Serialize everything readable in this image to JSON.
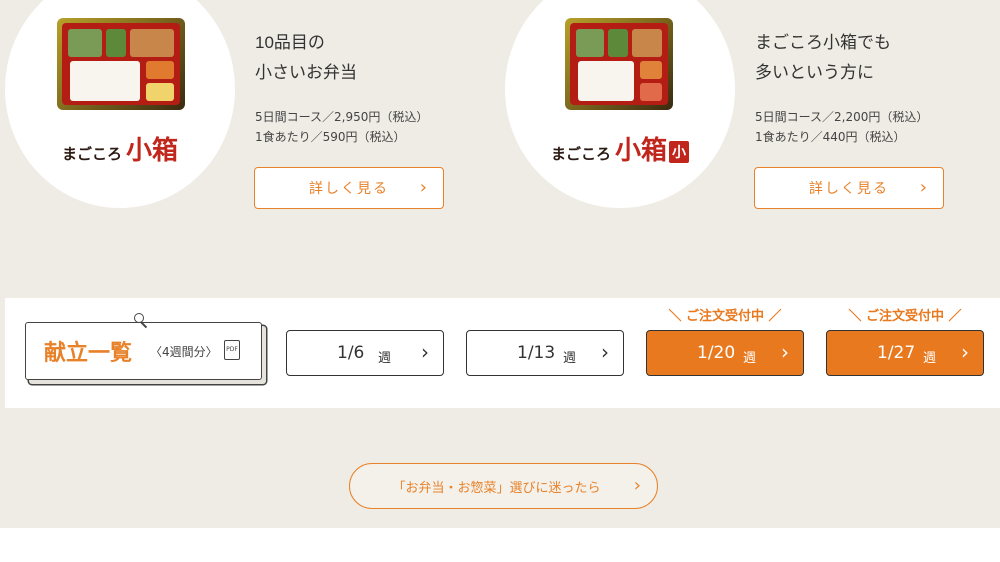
{
  "products": [
    {
      "logo_small": "まごころ",
      "logo_main": "小箱",
      "logo_badge": "",
      "title": "10品目の\n小さいお弁当",
      "price_course": "5日間コース／2,950円（税込）",
      "price_meal": "1食あたり／590円（税込）",
      "detail_label": "詳しく見る"
    },
    {
      "logo_small": "まごころ",
      "logo_main": "小箱",
      "logo_badge": "小",
      "title": "まごころ小箱でも\n多いという方に",
      "price_course": "5日間コース／2,200円（税込）",
      "price_meal": "1食あたり／440円（税込）",
      "detail_label": "詳しく見る"
    }
  ],
  "menu": {
    "title": "献立一覧",
    "subtitle": "〈4週間分〉",
    "pdf_label": "PDF",
    "accepting_label": "＼ ご注文受付中 ／",
    "weeks": [
      {
        "date": "1/6",
        "unit": "週",
        "active": false
      },
      {
        "date": "1/13",
        "unit": "週",
        "active": false
      },
      {
        "date": "1/20",
        "unit": "週",
        "active": true
      },
      {
        "date": "1/27",
        "unit": "週",
        "active": true
      }
    ]
  },
  "guide": {
    "label": "「お弁当・お惣菜」選びに迷ったら"
  },
  "icons": {
    "chevron": "chevron-right-icon",
    "pdf": "pdf-icon",
    "pin": "pin-icon"
  },
  "colors": {
    "accent": "#e8791f",
    "background": "#efece5",
    "logo_red": "#c0261c"
  }
}
